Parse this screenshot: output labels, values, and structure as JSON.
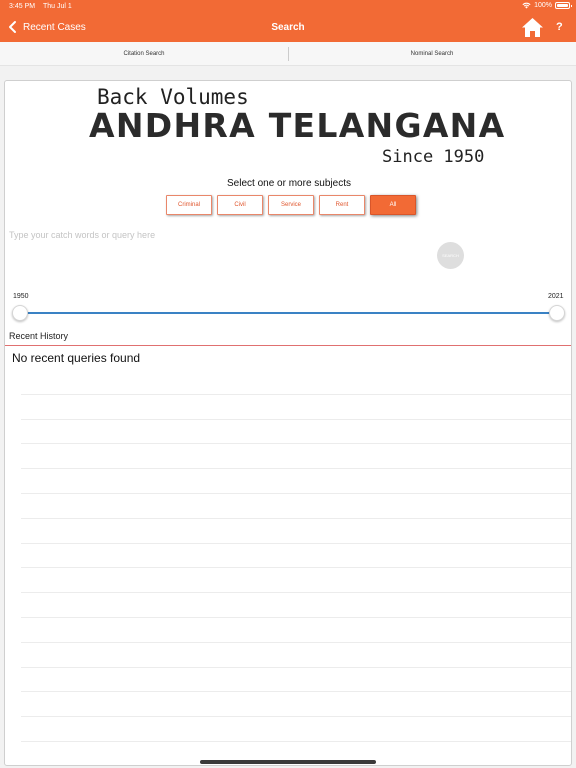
{
  "status_bar": {
    "time": "3:45 PM",
    "date": "Thu Jul 1",
    "battery": "100%"
  },
  "nav": {
    "back_label": "Recent Cases",
    "title": "Search",
    "help_label": "?"
  },
  "segments": {
    "left": "Citation Search",
    "right": "Nominal Search"
  },
  "logo": {
    "line1": "Back Volumes",
    "line2": "ANDHRA TELANGANA",
    "line3": "Since 1950"
  },
  "subjects": {
    "prompt": "Select one or more subjects",
    "options": [
      "Criminal",
      "Civil",
      "Service",
      "Rent",
      "All"
    ],
    "selected": "All"
  },
  "query": {
    "placeholder": "Type your catch words or query here",
    "value": "",
    "button_label": "SEARCH"
  },
  "year_range": {
    "min_label": "1950",
    "max_label": "2021",
    "min": 1950,
    "max": 2021
  },
  "history": {
    "label": "Recent History",
    "empty_message": "No recent queries found"
  },
  "colors": {
    "accent": "#f26a35",
    "slider": "#3a82c4",
    "divider": "#e07070"
  }
}
